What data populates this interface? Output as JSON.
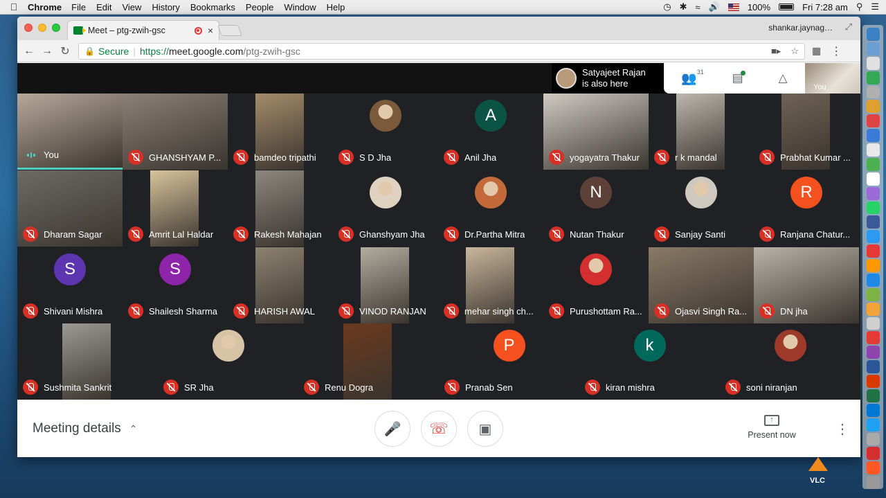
{
  "menubar": {
    "app_name": "Chrome",
    "items": [
      "File",
      "Edit",
      "View",
      "History",
      "Bookmarks",
      "People",
      "Window",
      "Help"
    ],
    "battery": "100%",
    "clock": "Fri 7:28 am"
  },
  "browser": {
    "tab_title": "Meet – ptg-zwih-gsc",
    "profile": "shankar.jaynag…",
    "secure_label": "Secure",
    "url_scheme": "https://",
    "url_host": "meet.google.com",
    "url_path": "/ptg-zwih-gsc"
  },
  "meet": {
    "notice_line1": "Satyajeet Rajan",
    "notice_line2": "is also here",
    "people_count": "31",
    "self_label": "You",
    "tiles": [
      {
        "name": "You",
        "type": "video",
        "muted": false,
        "self": true,
        "bg": "#b7a89a"
      },
      {
        "name": "GHANSHYAM P...",
        "type": "video",
        "muted": true,
        "bg": "#8a8178"
      },
      {
        "name": "bamdeo tripathi",
        "type": "video",
        "muted": true,
        "bg": "#a48c6a"
      },
      {
        "name": "S D Jha",
        "type": "photo",
        "muted": true,
        "bg": "#7a5a3a"
      },
      {
        "name": "Anil Jha",
        "type": "letter",
        "letter": "A",
        "muted": true,
        "bg": "#0b5345"
      },
      {
        "name": "yogayatra Thakur",
        "type": "video",
        "muted": true,
        "bg": "#cfcac2"
      },
      {
        "name": "r k mandal",
        "type": "video",
        "muted": true,
        "bg": "#bdb6ae"
      },
      {
        "name": "Prabhat Kumar ...",
        "type": "video",
        "muted": true,
        "bg": "#6f6255"
      },
      {
        "name": "Dharam Sagar",
        "type": "video",
        "muted": true,
        "bg": "#6d6a66"
      },
      {
        "name": "Amrit Lal Haldar",
        "type": "video",
        "muted": true,
        "bg": "#d8c49c"
      },
      {
        "name": "Rakesh Mahajan",
        "type": "video",
        "muted": true,
        "bg": "#8d877f"
      },
      {
        "name": "Ghanshyam Jha",
        "type": "photo",
        "muted": true,
        "bg": "#e0d2c0"
      },
      {
        "name": "Dr.Partha Mitra",
        "type": "photo",
        "muted": true,
        "bg": "#c46a3a"
      },
      {
        "name": "Nutan Thakur",
        "type": "letter",
        "letter": "N",
        "muted": true,
        "bg": "#5d4037"
      },
      {
        "name": "Sanjay Santi",
        "type": "photo",
        "muted": true,
        "bg": "#cfc8bf"
      },
      {
        "name": "Ranjana Chatur...",
        "type": "letter",
        "letter": "R",
        "muted": true,
        "bg": "#f4511e"
      },
      {
        "name": "Shivani Mishra",
        "type": "letter",
        "letter": "S",
        "muted": true,
        "bg": "#5e35b1"
      },
      {
        "name": "Shailesh Sharma",
        "type": "letter",
        "letter": "S",
        "muted": true,
        "bg": "#8e24aa"
      },
      {
        "name": "HARISH AWAL",
        "type": "video",
        "muted": true,
        "bg": "#8d8271"
      },
      {
        "name": "VINOD RANJAN",
        "type": "video",
        "muted": true,
        "bg": "#b3aca0"
      },
      {
        "name": "mehar singh ch...",
        "type": "video",
        "muted": true,
        "bg": "#c9b69b"
      },
      {
        "name": "Purushottam Ra...",
        "type": "photo",
        "muted": true,
        "bg": "#d32f2f"
      },
      {
        "name": "Ojasvi Singh Ra...",
        "type": "video",
        "muted": true,
        "bg": "#8a7a66"
      },
      {
        "name": "DN jha",
        "type": "video",
        "muted": true,
        "bg": "#b9b2a8"
      },
      {
        "name": "Sushmita Sankrit",
        "type": "video",
        "muted": true,
        "bg": "#9c9a94"
      },
      {
        "name": "SR Jha",
        "type": "photo",
        "muted": true,
        "bg": "#d7c3a5"
      },
      {
        "name": "Renu Dogra",
        "type": "video",
        "muted": true,
        "bg": "#6b3a1e"
      },
      {
        "name": "Pranab Sen",
        "type": "letter",
        "letter": "P",
        "muted": true,
        "bg": "#f4511e"
      },
      {
        "name": "kiran mishra",
        "type": "letter",
        "letter": "k",
        "muted": true,
        "bg": "#00695c"
      },
      {
        "name": "soni niranjan",
        "type": "photo",
        "muted": true,
        "bg": "#9e3a2a"
      }
    ],
    "meeting_details": "Meeting details",
    "present_now": "Present now"
  },
  "dock": {
    "vlc_label": "VLC",
    "icon_colors": [
      "#3b82c4",
      "#6a9fd6",
      "#e0e0e0",
      "#34a853",
      "#b0b0b0",
      "#e0a030",
      "#d44",
      "#3a7bd5",
      "#e8e8e8",
      "#4caf50",
      "#ffffff",
      "#9c6ad6",
      "#25d366",
      "#3b5998",
      "#2b9af3",
      "#e53935",
      "#ff9800",
      "#1e88e5",
      "#7cb342",
      "#f2a33a",
      "#cfcfcf",
      "#e53935",
      "#8e44ad",
      "#2b579a",
      "#d83b01",
      "#217346",
      "#0078d4",
      "#1da1f2",
      "#aaaaaa",
      "#d32f2f",
      "#ff5722",
      "#999999"
    ]
  }
}
